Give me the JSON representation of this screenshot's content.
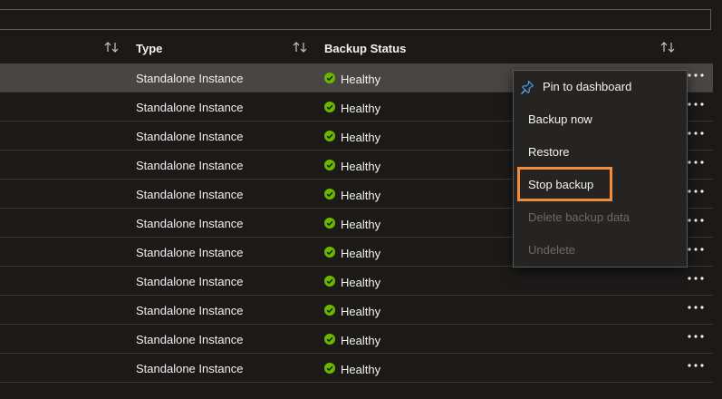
{
  "header": {
    "col_type": "Type",
    "col_backup_status": "Backup Status"
  },
  "rows": [
    {
      "type": "Standalone Instance",
      "status": "Healthy"
    },
    {
      "type": "Standalone Instance",
      "status": "Healthy"
    },
    {
      "type": "Standalone Instance",
      "status": "Healthy"
    },
    {
      "type": "Standalone Instance",
      "status": "Healthy"
    },
    {
      "type": "Standalone Instance",
      "status": "Healthy"
    },
    {
      "type": "Standalone Instance",
      "status": "Healthy"
    },
    {
      "type": "Standalone Instance",
      "status": "Healthy"
    },
    {
      "type": "Standalone Instance",
      "status": "Healthy"
    },
    {
      "type": "Standalone Instance",
      "status": "Healthy"
    },
    {
      "type": "Standalone Instance",
      "status": "Healthy"
    },
    {
      "type": "Standalone Instance",
      "status": "Healthy"
    }
  ],
  "context_menu": {
    "items": [
      {
        "label": "Pin to dashboard",
        "icon": "pin-icon",
        "enabled": true
      },
      {
        "label": "Backup now",
        "enabled": true
      },
      {
        "label": "Restore",
        "enabled": true
      },
      {
        "label": "Stop backup",
        "enabled": true,
        "highlighted": true
      },
      {
        "label": "Delete backup data",
        "enabled": false
      },
      {
        "label": "Undelete",
        "enabled": false
      }
    ]
  },
  "colors": {
    "background": "#1b1a19",
    "selected_row": "#484644",
    "healthy_green": "#6bb700",
    "highlight_orange": "#f08c3a",
    "pin_blue": "#4f9fe8",
    "disabled_text": "#6b6a69"
  },
  "icons": {
    "sort": "sort-arrows-icon",
    "status": "check-circle-icon",
    "more": "more-ellipsis-icon"
  }
}
